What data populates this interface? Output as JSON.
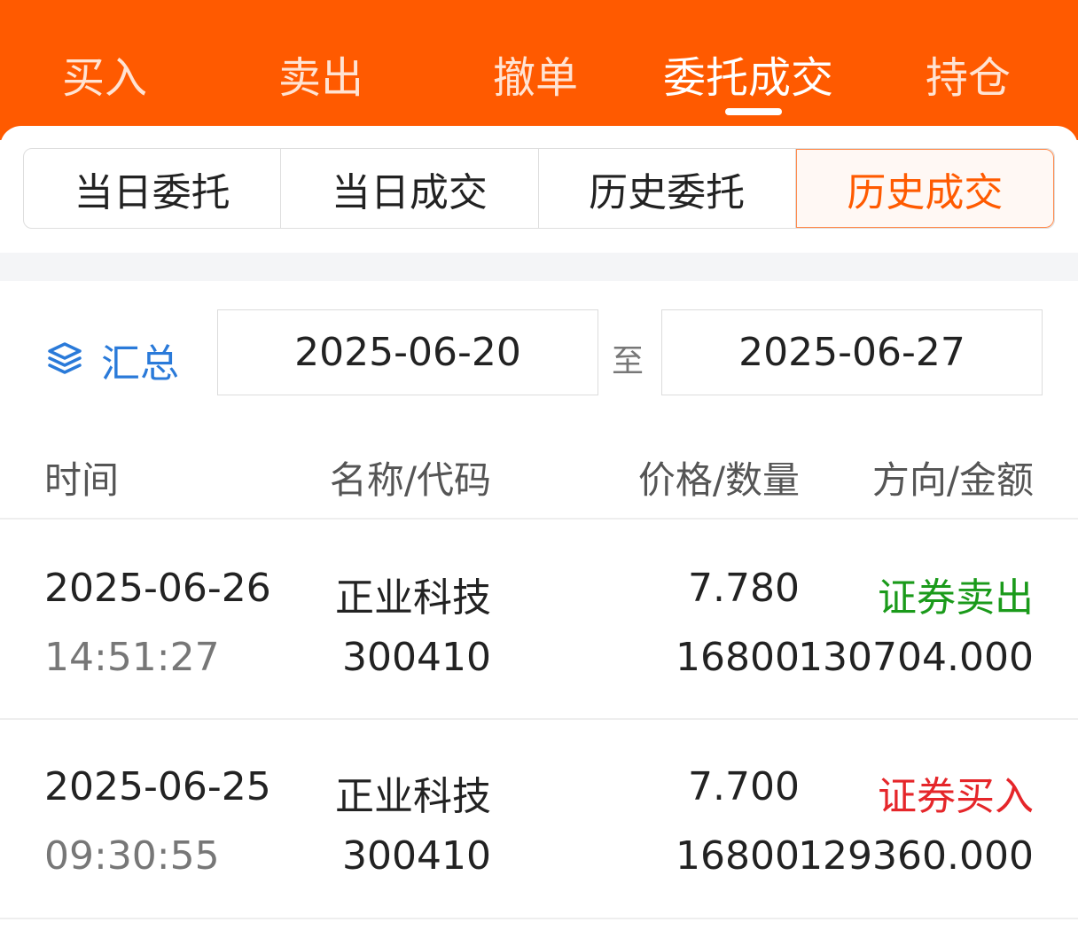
{
  "colors": {
    "brand": "#ff5a00",
    "link": "#2a7ad9",
    "sell": "#1a9a1a",
    "buy": "#e5262a"
  },
  "top_tabs": [
    {
      "label": "买入"
    },
    {
      "label": "卖出"
    },
    {
      "label": "撤单"
    },
    {
      "label": "委托成交"
    },
    {
      "label": "持仓"
    }
  ],
  "sub_tabs": [
    {
      "label": "当日委托"
    },
    {
      "label": "当日成交"
    },
    {
      "label": "历史委托"
    },
    {
      "label": "历史成交"
    }
  ],
  "filter": {
    "summary_label": "汇总",
    "summary_icon": "layers-icon",
    "start_date": "2025-06-20",
    "separator": "至",
    "end_date": "2025-06-27"
  },
  "table": {
    "headers": [
      "时间",
      "名称/代码",
      "价格/数量",
      "方向/金额"
    ],
    "rows": [
      {
        "date": "2025-06-26",
        "time": "14:51:27",
        "name": "正业科技",
        "code": "300410",
        "price": "7.780",
        "quantity": "16800",
        "direction": "证券卖出",
        "amount": "130704.000"
      },
      {
        "date": "2025-06-25",
        "time": "09:30:55",
        "name": "正业科技",
        "code": "300410",
        "price": "7.700",
        "quantity": "16800",
        "direction": "证券买入",
        "amount": "129360.000"
      }
    ]
  }
}
